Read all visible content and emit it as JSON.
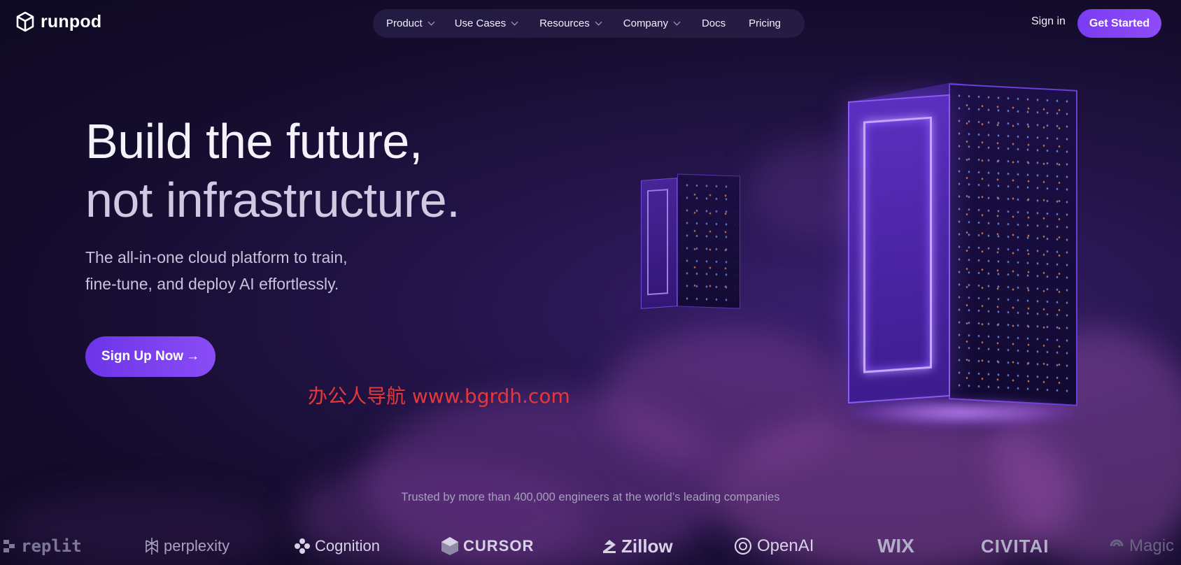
{
  "brand": {
    "name": "runpod",
    "icon": "cube-logo-icon"
  },
  "nav": {
    "items": [
      {
        "label": "Product",
        "dropdown": true
      },
      {
        "label": "Use Cases",
        "dropdown": true
      },
      {
        "label": "Resources",
        "dropdown": true
      },
      {
        "label": "Company",
        "dropdown": true
      },
      {
        "label": "Docs",
        "dropdown": false
      },
      {
        "label": "Pricing",
        "dropdown": false
      }
    ],
    "signin": "Sign in",
    "cta": "Get Started"
  },
  "hero": {
    "headline_line1": "Build the future,",
    "headline_line2": "not infrastructure.",
    "subhead_line1": "The all-in-one cloud platform to train,",
    "subhead_line2": "fine-tune, and deploy AI effortlessly.",
    "cta": "Sign Up Now",
    "cta_arrow": "→"
  },
  "watermark": "办公人导航 www.bgrdh.com",
  "trust": {
    "text": "Trusted by more than 400,000 engineers at the world’s leading companies",
    "companies": [
      "replit",
      "perplexity",
      "Cognition",
      "CURSOR",
      "Zillow",
      "OpenAI",
      "WIX",
      "CIVITAI",
      "Magic"
    ]
  },
  "colors": {
    "accent": "#7a3cf2",
    "background": "#1a1038",
    "watermark": "#e4383a"
  }
}
